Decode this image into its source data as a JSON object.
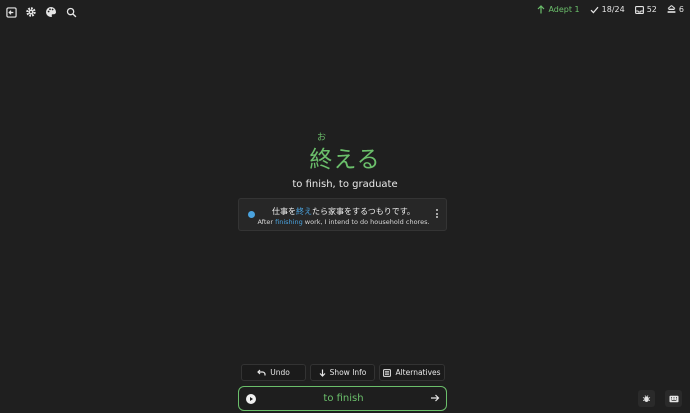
{
  "topbar": {
    "level_label": "Adept 1",
    "progress": "18/24",
    "reviews": "52",
    "lessons": "6"
  },
  "card": {
    "furigana": "お",
    "word": "終える",
    "meaning": "to finish, to graduate"
  },
  "example": {
    "jp_before": "仕事を",
    "jp_highlight": "終え",
    "jp_after": "たら家事をするつもりです。",
    "en_before": "After ",
    "en_highlight": "finishing",
    "en_after": " work, I intend to do household chores."
  },
  "buttons": {
    "undo": "Undo",
    "show_info": "Show Info",
    "alternatives": "Alternatives"
  },
  "answer": {
    "value": "to finish"
  },
  "colors": {
    "accent_green": "#6bbf6b",
    "highlight_blue": "#4aa3df",
    "background": "#1f1f1f"
  }
}
